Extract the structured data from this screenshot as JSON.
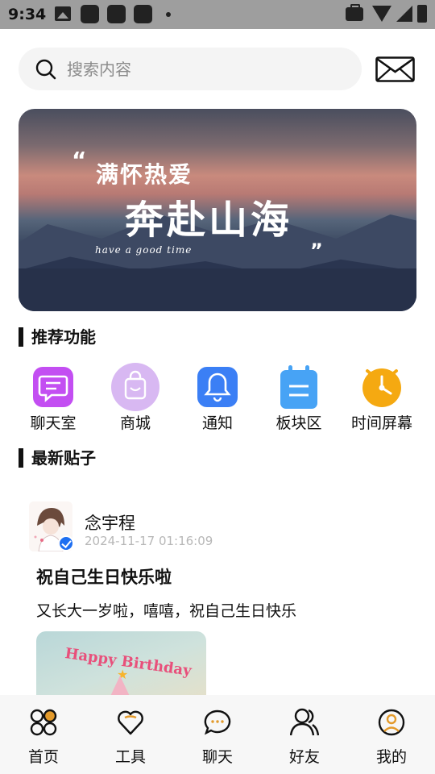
{
  "status_bar": {
    "time": "9:34",
    "icons": [
      "gallery-icon",
      "app-icon",
      "app-icon",
      "app-icon",
      "dot-icon",
      "briefcase-icon",
      "wifi-icon",
      "signal-icon",
      "battery-icon"
    ]
  },
  "search": {
    "placeholder": "搜索内容",
    "icon": "search-icon"
  },
  "header": {
    "mail_icon": "mail-icon"
  },
  "banner": {
    "quote_open": "“",
    "line1": "满怀热爱",
    "line2": "奔赴山海",
    "line3": "have a good time",
    "quote_close": "”"
  },
  "recommended": {
    "title": "推荐功能",
    "items": [
      {
        "label": "聊天室",
        "icon": "chat-room-icon",
        "color": "#c34ef2"
      },
      {
        "label": "商城",
        "icon": "shopping-bag-icon",
        "color": "#d8b8f2"
      },
      {
        "label": "通知",
        "icon": "bell-icon",
        "color": "#3b7ff5"
      },
      {
        "label": "板块区",
        "icon": "clipboard-icon",
        "color": "#47a3f5"
      },
      {
        "label": "时间屏幕",
        "icon": "clock-icon",
        "color": "#f5a911"
      }
    ]
  },
  "latest": {
    "title": "最新贴子",
    "post": {
      "author": "念宇程",
      "timestamp": "2024-11-17 01:16:09",
      "title": "祝自己生日快乐啦",
      "body": "又长大一岁啦，嘻嘻，祝自己生日快乐",
      "image_text": "Happy Birthday",
      "verified_color": "#1e6ff1"
    }
  },
  "bottom_nav": {
    "tabs": [
      {
        "label": "首页",
        "icon": "home-icon"
      },
      {
        "label": "工具",
        "icon": "heart-icon"
      },
      {
        "label": "聊天",
        "icon": "chat-bubble-icon"
      },
      {
        "label": "好友",
        "icon": "friends-icon"
      },
      {
        "label": "我的",
        "icon": "profile-icon"
      }
    ]
  },
  "colors": {
    "status_bar_bg": "#9e9e9e",
    "search_bg": "#f4f4f4",
    "nav_bg": "#f7f7f7",
    "nav_accent": "#e39a2b"
  }
}
